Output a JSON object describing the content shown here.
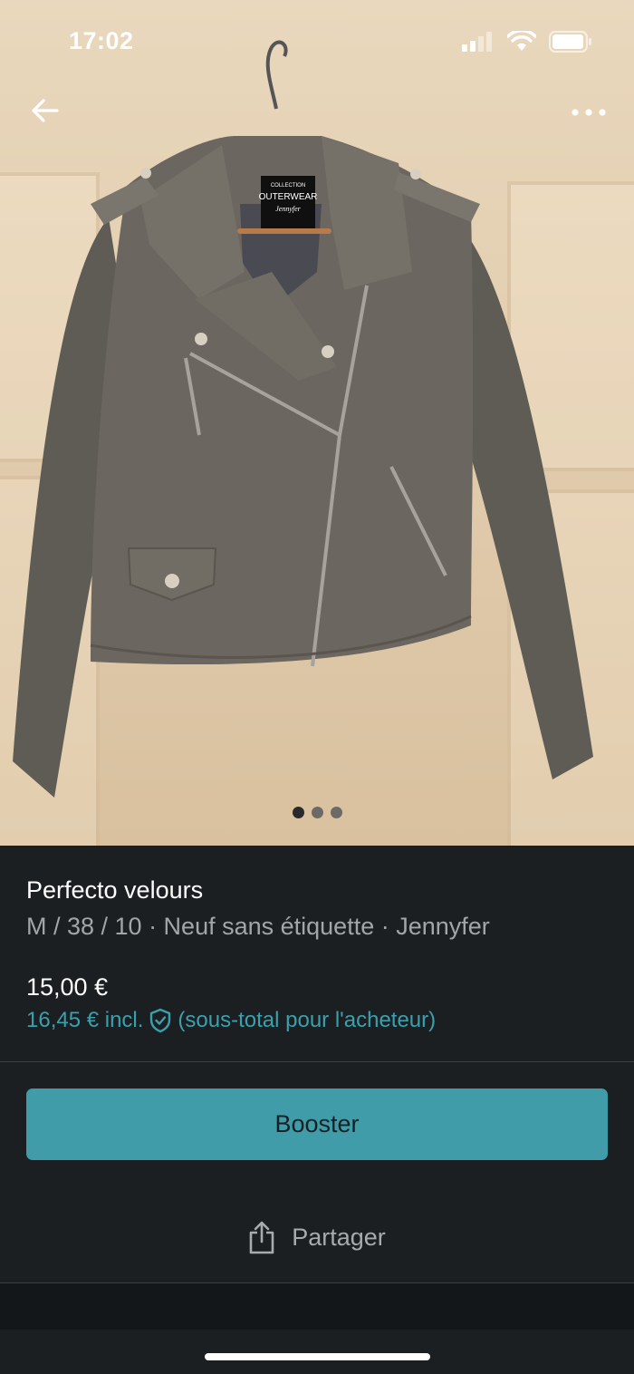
{
  "status_bar": {
    "time": "17:02"
  },
  "gallery": {
    "image_count": 3,
    "active_index": 0
  },
  "listing": {
    "title": "Perfecto velours",
    "subtitle": "M / 38 / 10 · Neuf sans étiquette · Jennyfer",
    "price": "15,00 €",
    "price_incl": "16,45 € incl.",
    "price_incl_note": "(sous-total pour l'acheteur)"
  },
  "label_tag": {
    "line1": "COLLECTION",
    "line2": "OUTERWEAR",
    "line3": "Jennyfer"
  },
  "actions": {
    "booster_label": "Booster",
    "share_label": "Partager"
  },
  "icons": {
    "back": "arrow-left-icon",
    "more": "more-horizontal-icon",
    "shield": "shield-check-icon",
    "share": "share-icon"
  },
  "colors": {
    "accent": "#409ca8",
    "link": "#39a1ad",
    "background": "#1b1f21"
  }
}
